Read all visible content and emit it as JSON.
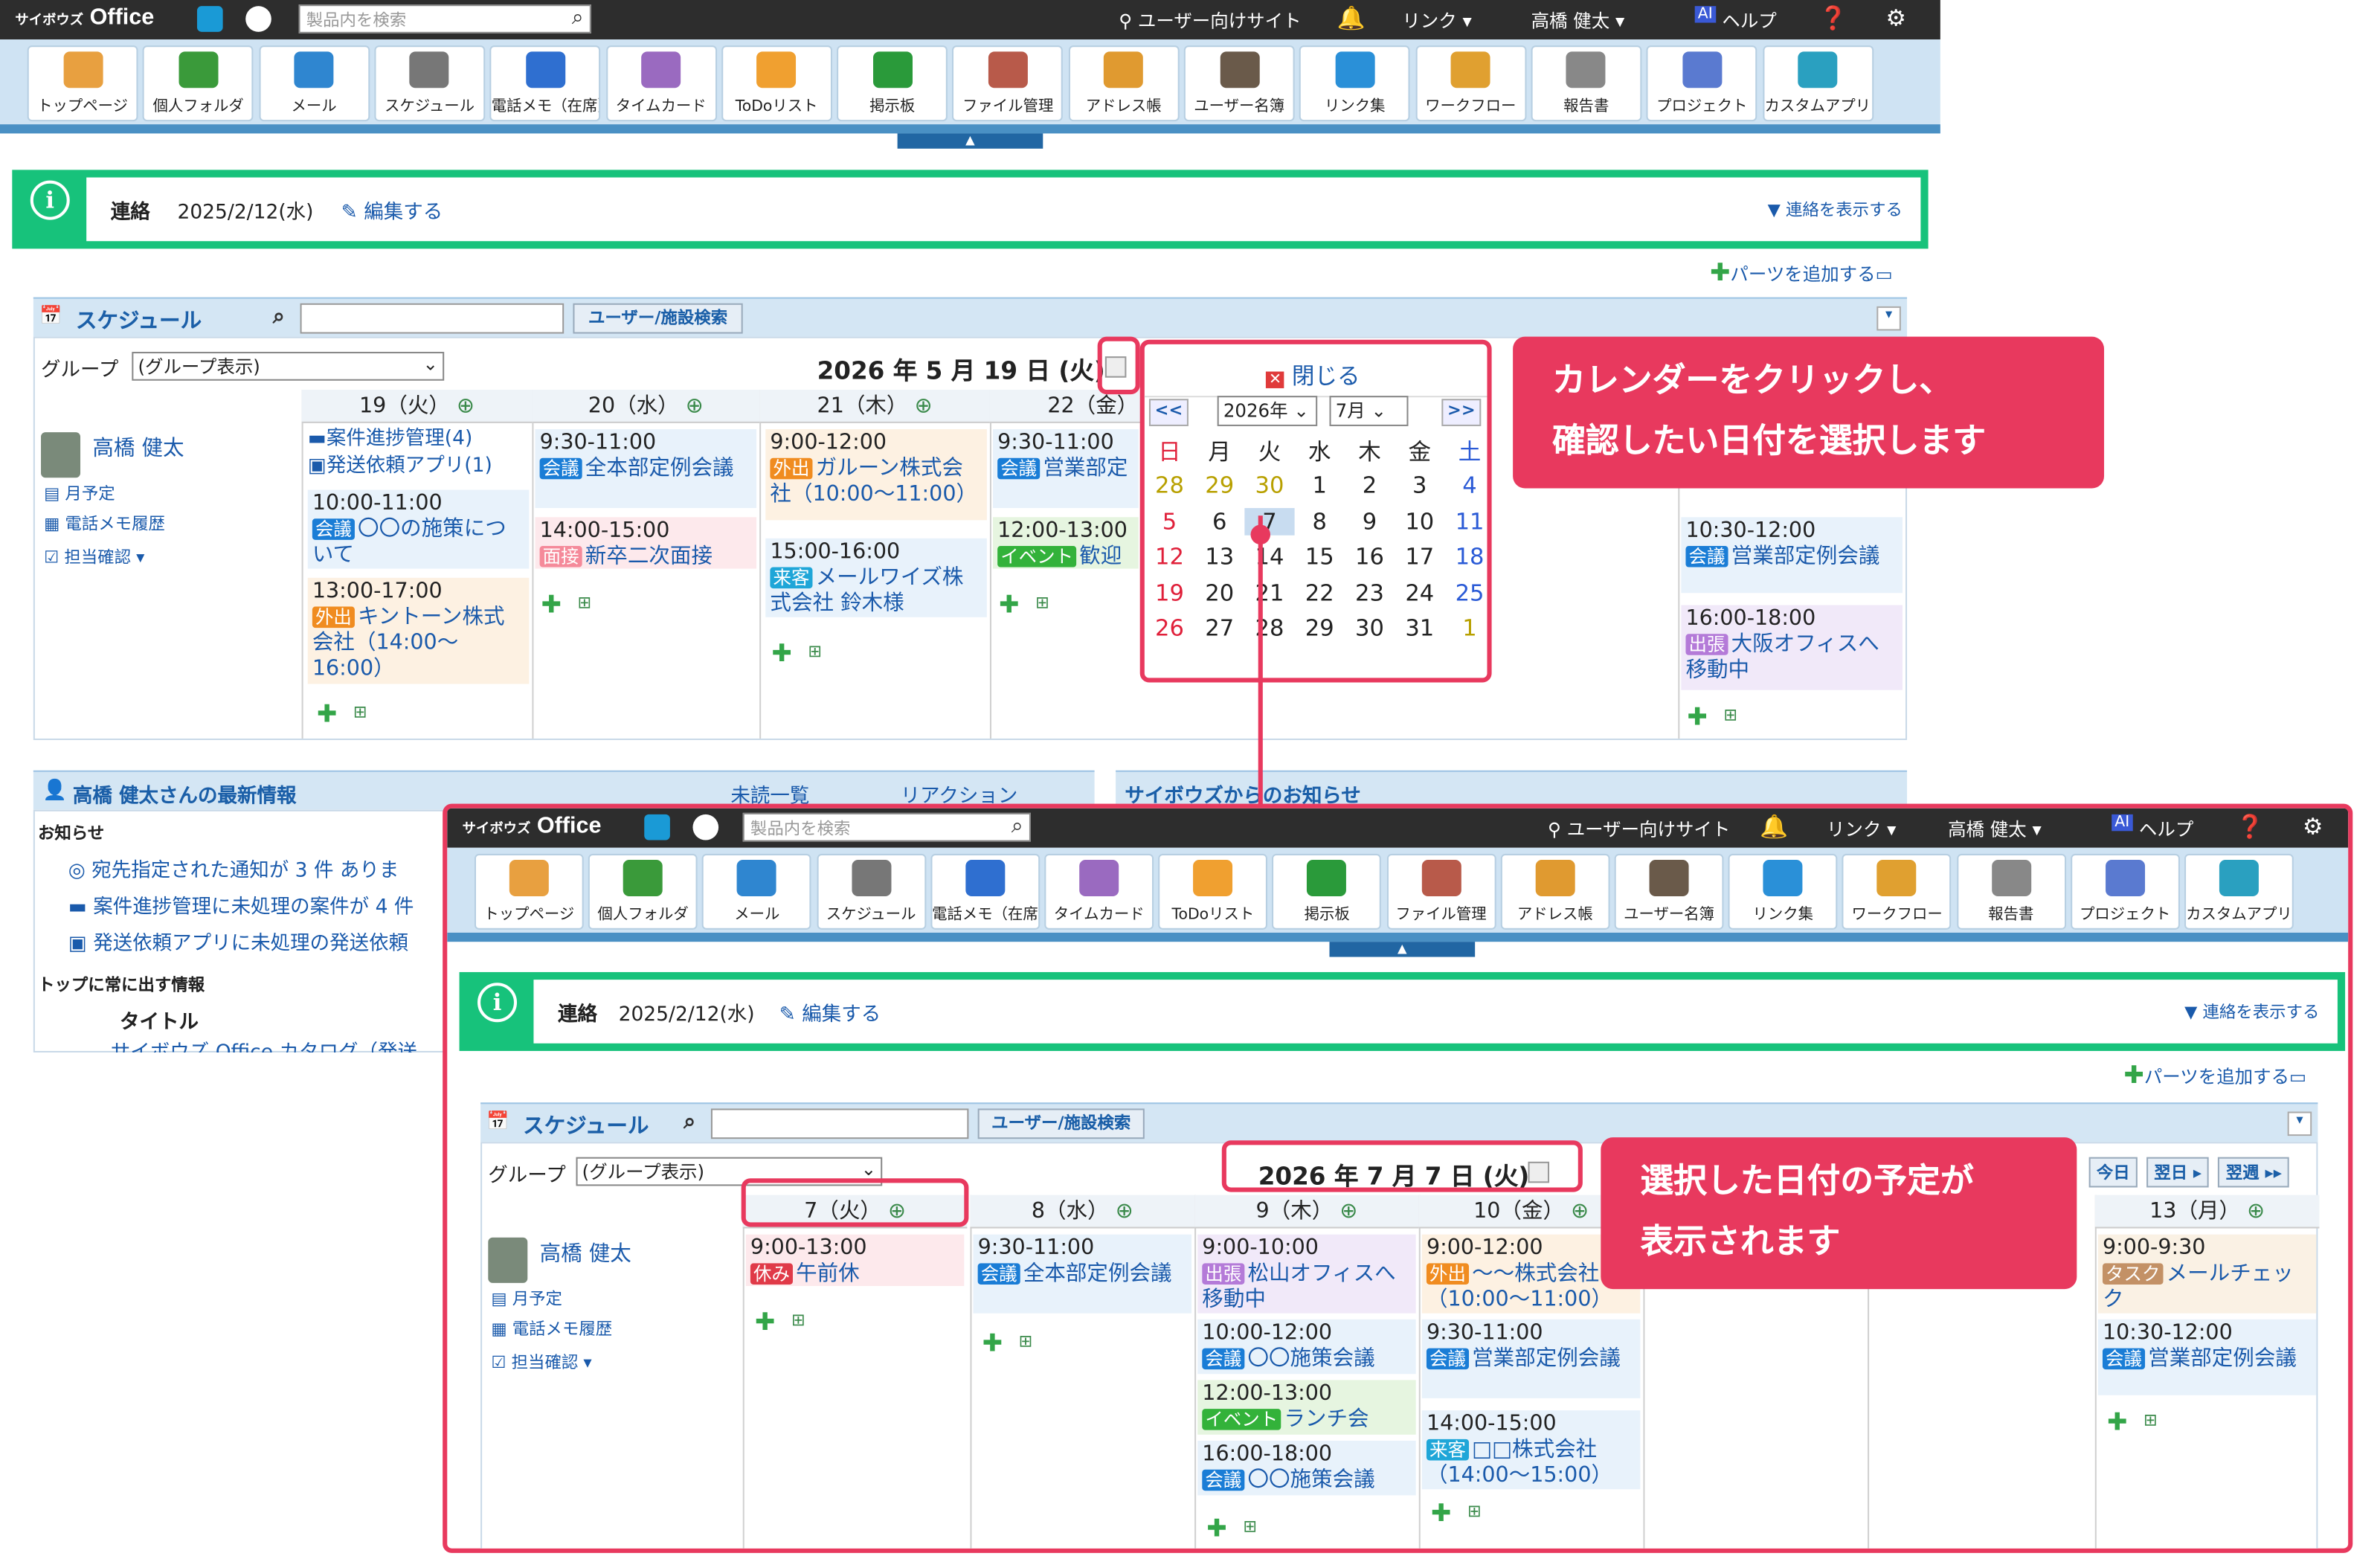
{
  "topbar": {
    "logo": "Office",
    "logo_small": "サイボウズ",
    "search_placeholder": "製品内を検索",
    "user_site": "ユーザー向けサイト",
    "link": "リンク ▾",
    "user": "高橋 健太 ▾",
    "help": "ヘルプ",
    "ai": "AI"
  },
  "apps": [
    "トップページ",
    "個人フォルダ",
    "メール",
    "スケジュール",
    "電話メモ（在席）",
    "タイムカード",
    "ToDoリスト",
    "掲示板",
    "ファイル管理",
    "アドレス帳",
    "ユーザー名簿",
    "リンク集",
    "ワークフロー",
    "報告書",
    "プロジェクト",
    "カスタムアプリ"
  ],
  "notice": {
    "label": "連絡",
    "date": "2025/2/12(水)",
    "edit": "編集する",
    "toggle": "▼ 連絡を表示する"
  },
  "add_parts": "パーツを追加する",
  "schedule": {
    "title": "スケジュール",
    "user_search": "ユーザー/施設検索",
    "group_label": "グループ",
    "group_value": "(グループ表示)"
  },
  "user": {
    "name": "高橋 健太",
    "month": "月予定",
    "phone": "電話メモ履歴",
    "check": "担当確認"
  },
  "top": {
    "date": "2026 年 5 月 19 日 (火)",
    "days": [
      "19（火）",
      "20（水）",
      "21（木）",
      "22（金）"
    ],
    "d19": [
      "案件進捗管理(4)",
      "発送依頼アプリ(1)"
    ],
    "ev": [
      {
        "t": "10:00-11:00",
        "tag": "会議",
        "txt": "〇〇の施策について"
      },
      {
        "t": "13:00-17:00",
        "tag": "外出",
        "txt": "キントーン株式会社（14:00〜16:00）"
      },
      {
        "t": "9:30-11:00",
        "tag": "会議",
        "txt": "全本部定例会議"
      },
      {
        "t": "14:00-15:00",
        "tag": "面接",
        "txt": "新卒二次面接"
      },
      {
        "t": "9:00-12:00",
        "tag": "外出",
        "txt": "ガルーン株式会社（10:00〜11:00）"
      },
      {
        "t": "15:00-16:00",
        "tag": "来客",
        "txt": "メールワイズ株式会社 鈴木様"
      },
      {
        "t": "9:30-11:00",
        "tag": "会議",
        "txt": "営業部定"
      },
      {
        "t": "12:00-13:00",
        "tag": "イベント",
        "txt": "歓迎"
      },
      {
        "t": "10:30-12:00",
        "tag": "会議",
        "txt": "営業部定例会議"
      },
      {
        "t": "16:00-18:00",
        "tag": "出張",
        "txt": "大阪オフィスへ移動中"
      }
    ],
    "news_title": "高橋 健太さんの最新情報",
    "news_unread": "未読一覧",
    "news_reaction": "リアクション",
    "news_info": "お知らせ",
    "news_items": [
      "宛先指定された通知が 3 件 ありま",
      "案件進捗管理に未処理の案件が 4 件",
      "発送依頼アプリに未処理の発送依頼"
    ],
    "news_pin": "トップに常に出す情報",
    "news_title_col": "タイトル",
    "news_row": "サイボウズ Office カタログ（発送",
    "cybozu_info": "サイボウズからのお知らせ"
  },
  "calendar": {
    "close": "閉じる",
    "prev": "<<",
    "next": ">>",
    "year": "2026年",
    "month": "7月",
    "weekdays": [
      "日",
      "月",
      "火",
      "水",
      "木",
      "金",
      "土"
    ],
    "rows": [
      [
        "28",
        "29",
        "30",
        "1",
        "2",
        "3",
        "4"
      ],
      [
        "5",
        "6",
        "7",
        "8",
        "9",
        "10",
        "11"
      ],
      [
        "12",
        "13",
        "14",
        "15",
        "16",
        "17",
        "18"
      ],
      [
        "19",
        "20",
        "21",
        "22",
        "23",
        "24",
        "25"
      ],
      [
        "26",
        "27",
        "28",
        "29",
        "30",
        "31",
        "1"
      ]
    ]
  },
  "callout1": [
    "カレンダーをクリックし、",
    "確認したい日付を選択します"
  ],
  "callout2": [
    "選択した日付の予定が",
    "表示されます"
  ],
  "bottom": {
    "date": "2026 年 7 月 7 日 (火)",
    "days": [
      "7（火）",
      "8（水）",
      "9（木）",
      "10（金）",
      "13（月）"
    ],
    "nav": [
      "今日",
      "翌日 ▸",
      "翌週 ▸▸"
    ],
    "ev": [
      {
        "t": "9:00-13:00",
        "tag": "休み",
        "txt": "午前休"
      },
      {
        "t": "9:30-11:00",
        "tag": "会議",
        "txt": "全本部定例会議"
      },
      {
        "t": "9:00-10:00",
        "tag": "出張",
        "txt": "松山オフィスへ移動中"
      },
      {
        "t": "10:00-12:00",
        "tag": "会議",
        "txt": "〇〇施策会議"
      },
      {
        "t": "12:00-13:00",
        "tag": "イベント",
        "txt": "ランチ会"
      },
      {
        "t": "16:00-18:00",
        "tag": "会議",
        "txt": "〇〇施策会議"
      },
      {
        "t": "9:00-12:00",
        "tag": "外出",
        "txt": "〜〜株式会社（10:00〜11:00）"
      },
      {
        "t": "9:30-11:00",
        "tag": "会議",
        "txt": "営業部定例会議"
      },
      {
        "t": "14:00-15:00",
        "tag": "来客",
        "txt": "□□株式会社（14:00〜15:00）"
      },
      {
        "t": "9:00-9:30",
        "tag": "タスク",
        "txt": "メールチェック"
      },
      {
        "t": "10:30-12:00",
        "tag": "会議",
        "txt": "営業部定例会議"
      }
    ]
  }
}
